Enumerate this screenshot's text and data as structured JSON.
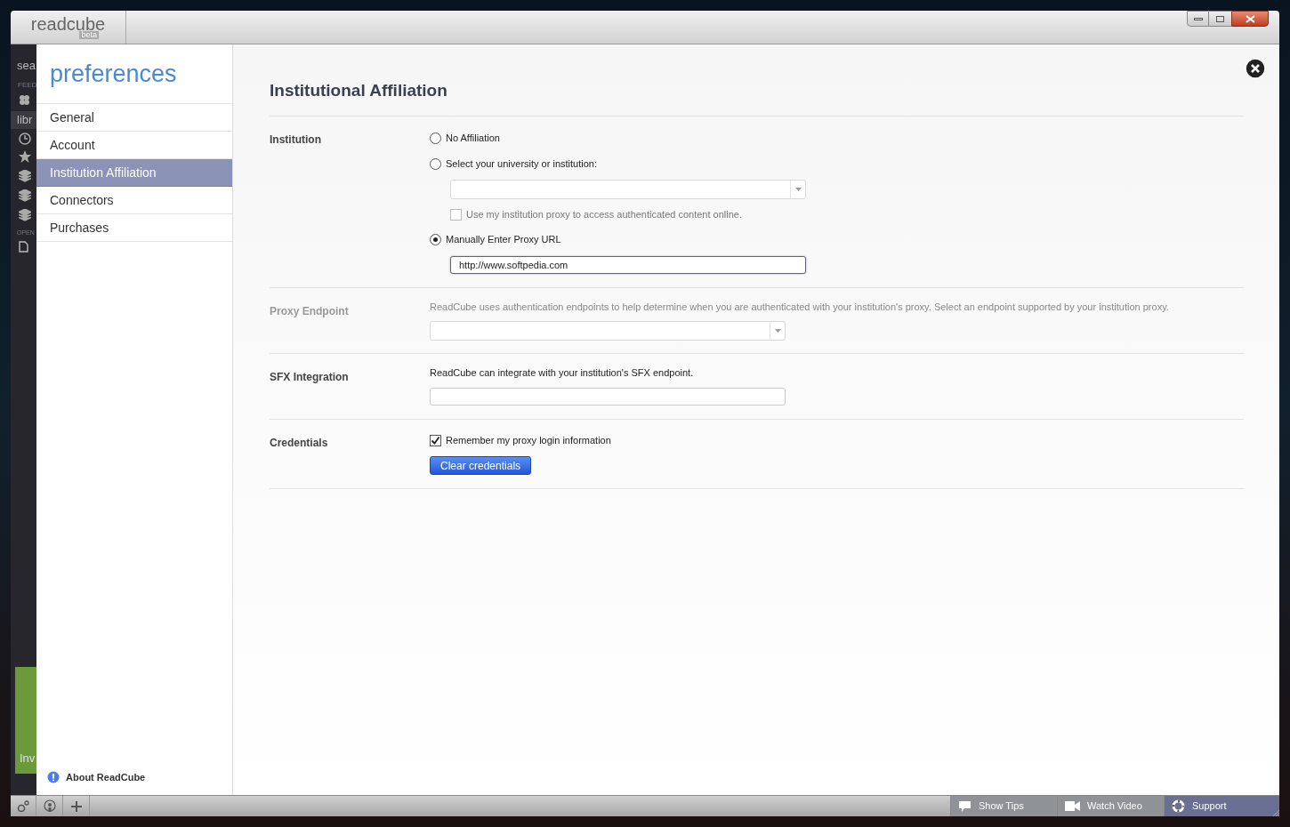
{
  "window": {
    "logo": "readcube",
    "logo_badge": "beta"
  },
  "background_sidebar": {
    "texts": [
      "sea",
      "FEED",
      "libr",
      "OPEN",
      "Inv"
    ]
  },
  "preferences": {
    "title": "preferences",
    "nav": [
      {
        "label": "General",
        "selected": false
      },
      {
        "label": "Account",
        "selected": false
      },
      {
        "label": "Institution Affiliation",
        "selected": true
      },
      {
        "label": "Connectors",
        "selected": false
      },
      {
        "label": "Purchases",
        "selected": false
      }
    ],
    "about": "About ReadCube"
  },
  "content": {
    "title": "Institutional Affiliation",
    "sections": [
      {
        "label": "Institution",
        "disabled": false,
        "rows": [
          {
            "kind": "radio",
            "label": "No Affiliation",
            "selected": false
          },
          {
            "kind": "radio",
            "label": "Select your university or institution:",
            "selected": false
          },
          {
            "kind": "select",
            "indent": true
          },
          {
            "kind": "checkbox",
            "label": "Use my institution proxy to access authenticated content online.",
            "checked": false,
            "disabled": true,
            "indent": true
          },
          {
            "kind": "radio",
            "label": "Manually Enter Proxy URL",
            "selected": true
          },
          {
            "kind": "text",
            "value": "http://www.softpedia.com",
            "focused": true,
            "indent": true
          }
        ]
      },
      {
        "label": "Proxy Endpoint",
        "disabled": true,
        "rows": [
          {
            "kind": "note",
            "text": "ReadCube uses authentication endpoints to help determine when you are authenticated with your institution's proxy.  Select an endpoint supported by your institution proxy."
          },
          {
            "kind": "select",
            "indent": false
          }
        ]
      },
      {
        "label": "SFX Integration",
        "disabled": false,
        "rows": [
          {
            "kind": "note",
            "text": "ReadCube can integrate with your institution's SFX endpoint."
          },
          {
            "kind": "text",
            "value": "",
            "focused": false,
            "indent": false
          }
        ]
      },
      {
        "label": "Credentials",
        "disabled": false,
        "rows": [
          {
            "kind": "checkbox",
            "label": "Remember my proxy login information",
            "checked": true,
            "disabled": false,
            "indent": false
          },
          {
            "kind": "button",
            "label": "Clear credentials"
          }
        ]
      }
    ]
  },
  "status_bar": {
    "buttons": [
      {
        "label": "Show Tips",
        "active": false
      },
      {
        "label": "Watch Video",
        "active": false
      },
      {
        "label": "Support",
        "active": true
      }
    ]
  }
}
